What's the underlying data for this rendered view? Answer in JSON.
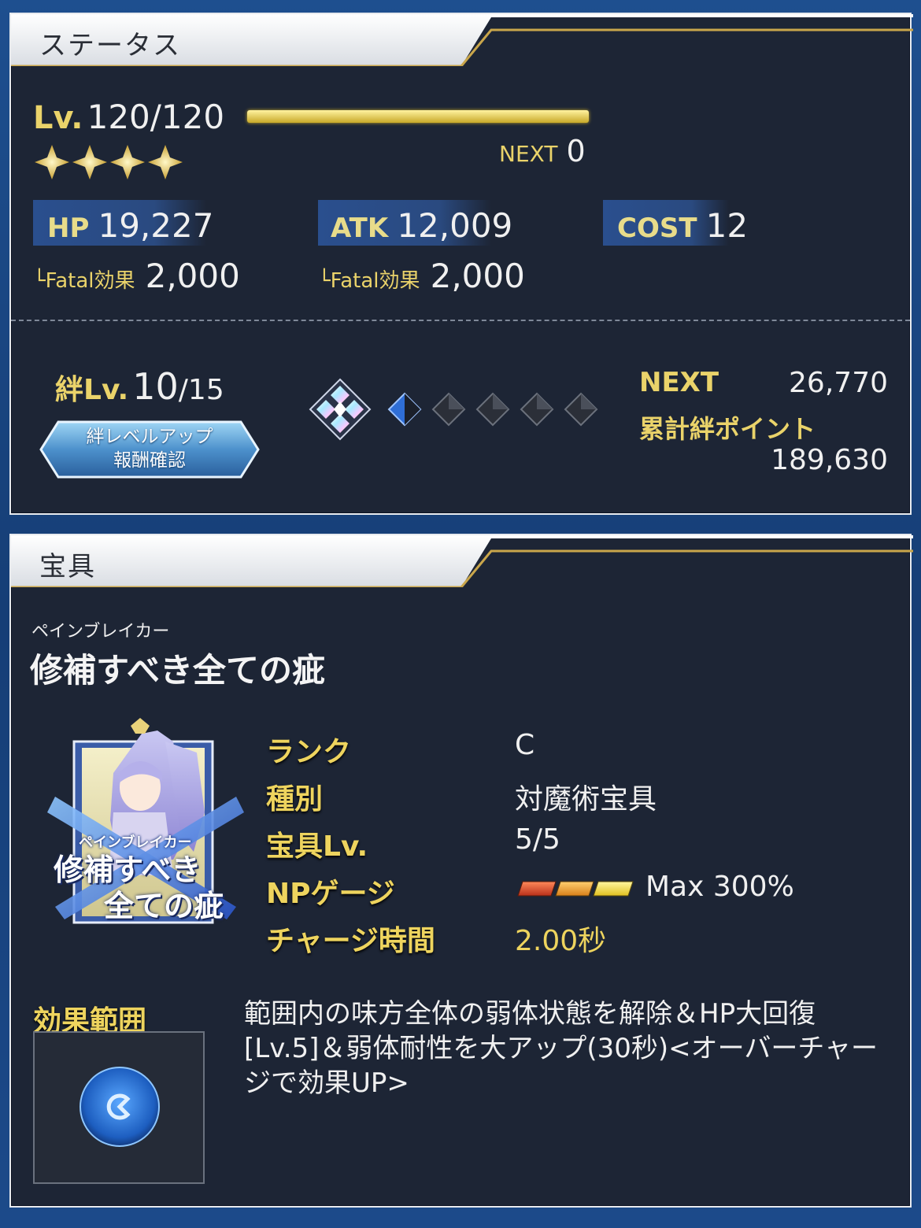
{
  "status": {
    "title": "ステータス",
    "level_label": "Lv.",
    "level_value": "120/120",
    "level_progress": 1.0,
    "next_label": "NEXT",
    "next_value": "0",
    "stars": 4,
    "hp": {
      "label": "HP",
      "value": "19,227",
      "fatal_label": "└Fatal効果",
      "fatal_value": "2,000"
    },
    "atk": {
      "label": "ATK",
      "value": "12,009",
      "fatal_label": "└Fatal効果",
      "fatal_value": "2,000"
    },
    "cost": {
      "label": "COST",
      "value": "12"
    },
    "bond": {
      "label": "絆Lv.",
      "level": "10",
      "max": "/15",
      "button_line1": "絆レベルアップ",
      "button_line2": "報酬確認",
      "next_label": "NEXT",
      "next_value": "26,770",
      "total_label": "累計絆ポイント",
      "total_value": "189,630",
      "gauge_filled": 1,
      "gauge_total": 5
    }
  },
  "noble_phantasm": {
    "title": "宝具",
    "ruby": "ペインブレイカー",
    "name": "修補すべき全ての疵",
    "card_ruby": "ペインブレイカー",
    "card_line1": "修補すべき",
    "card_line2": "全ての疵",
    "rows": [
      {
        "label": "ランク",
        "value": "C"
      },
      {
        "label": "種別",
        "value": "対魔術宝具"
      },
      {
        "label": "宝具Lv.",
        "value": "5/5"
      },
      {
        "label": "NPゲージ",
        "value": "Max 300%"
      },
      {
        "label": "チャージ時間",
        "value": "2.00秒"
      }
    ],
    "np_gauges": 3,
    "range_label": "効果範囲",
    "effect": "範囲内の味方全体の弱体状態を解除＆HP大回復[Lv.5]＆弱体耐性を大アップ(30秒)<オーバーチャージで効果UP>"
  },
  "colors": {
    "panel_bg": "#1d2535",
    "gold": "#ead36a",
    "stat_box": "#2a4f8e"
  }
}
